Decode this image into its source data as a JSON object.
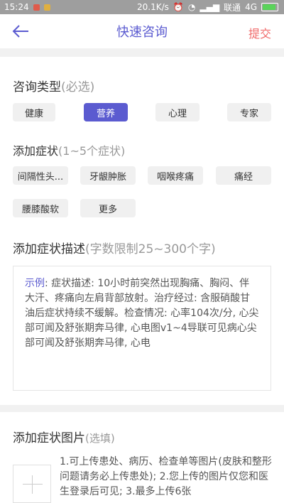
{
  "status": {
    "time": "15:24",
    "speed": "20.1K/s",
    "carrier": "联通",
    "network": "4G"
  },
  "header": {
    "title": "快速咨询",
    "submit": "提交"
  },
  "consult_type": {
    "title": "咨询类型",
    "hint": "(必选)",
    "options": [
      "健康",
      "营养",
      "心理",
      "专家"
    ],
    "selected": "营养"
  },
  "symptoms": {
    "title": "添加症状",
    "hint": "(1~5个症状)",
    "items": [
      "间隔性头...",
      "牙龈肿胀",
      "咽喉疼痛",
      "痛经",
      "腰膝酸软",
      "更多"
    ]
  },
  "description": {
    "title": "添加症状描述",
    "hint": "(字数限制25~300个字)",
    "example_label": "示例",
    "example_text": ": 症状描述: 10小时前突然出现胸痛、胸闷、伴大汗、疼痛向左肩背部放射。治疗经过: 含服硝酸甘油后症状持续不缓解。检查情况: 心率104次/分, 心尖部可闻及舒张期奔马律, 心电图v1~4导联可见病心尖部可闻及舒张期奔马律, 心电"
  },
  "images": {
    "title": "添加症状图片",
    "hint": "(选填)",
    "desc": "1.可上传患处、病历、检查单等图片(皮肤和整形问题请务必上传患处); 2.您上传的图片仅您和医生登录后可见; 3.最多上传6张"
  },
  "colors": {
    "accent": "#5b5bd0",
    "submit": "#f06a6a"
  }
}
